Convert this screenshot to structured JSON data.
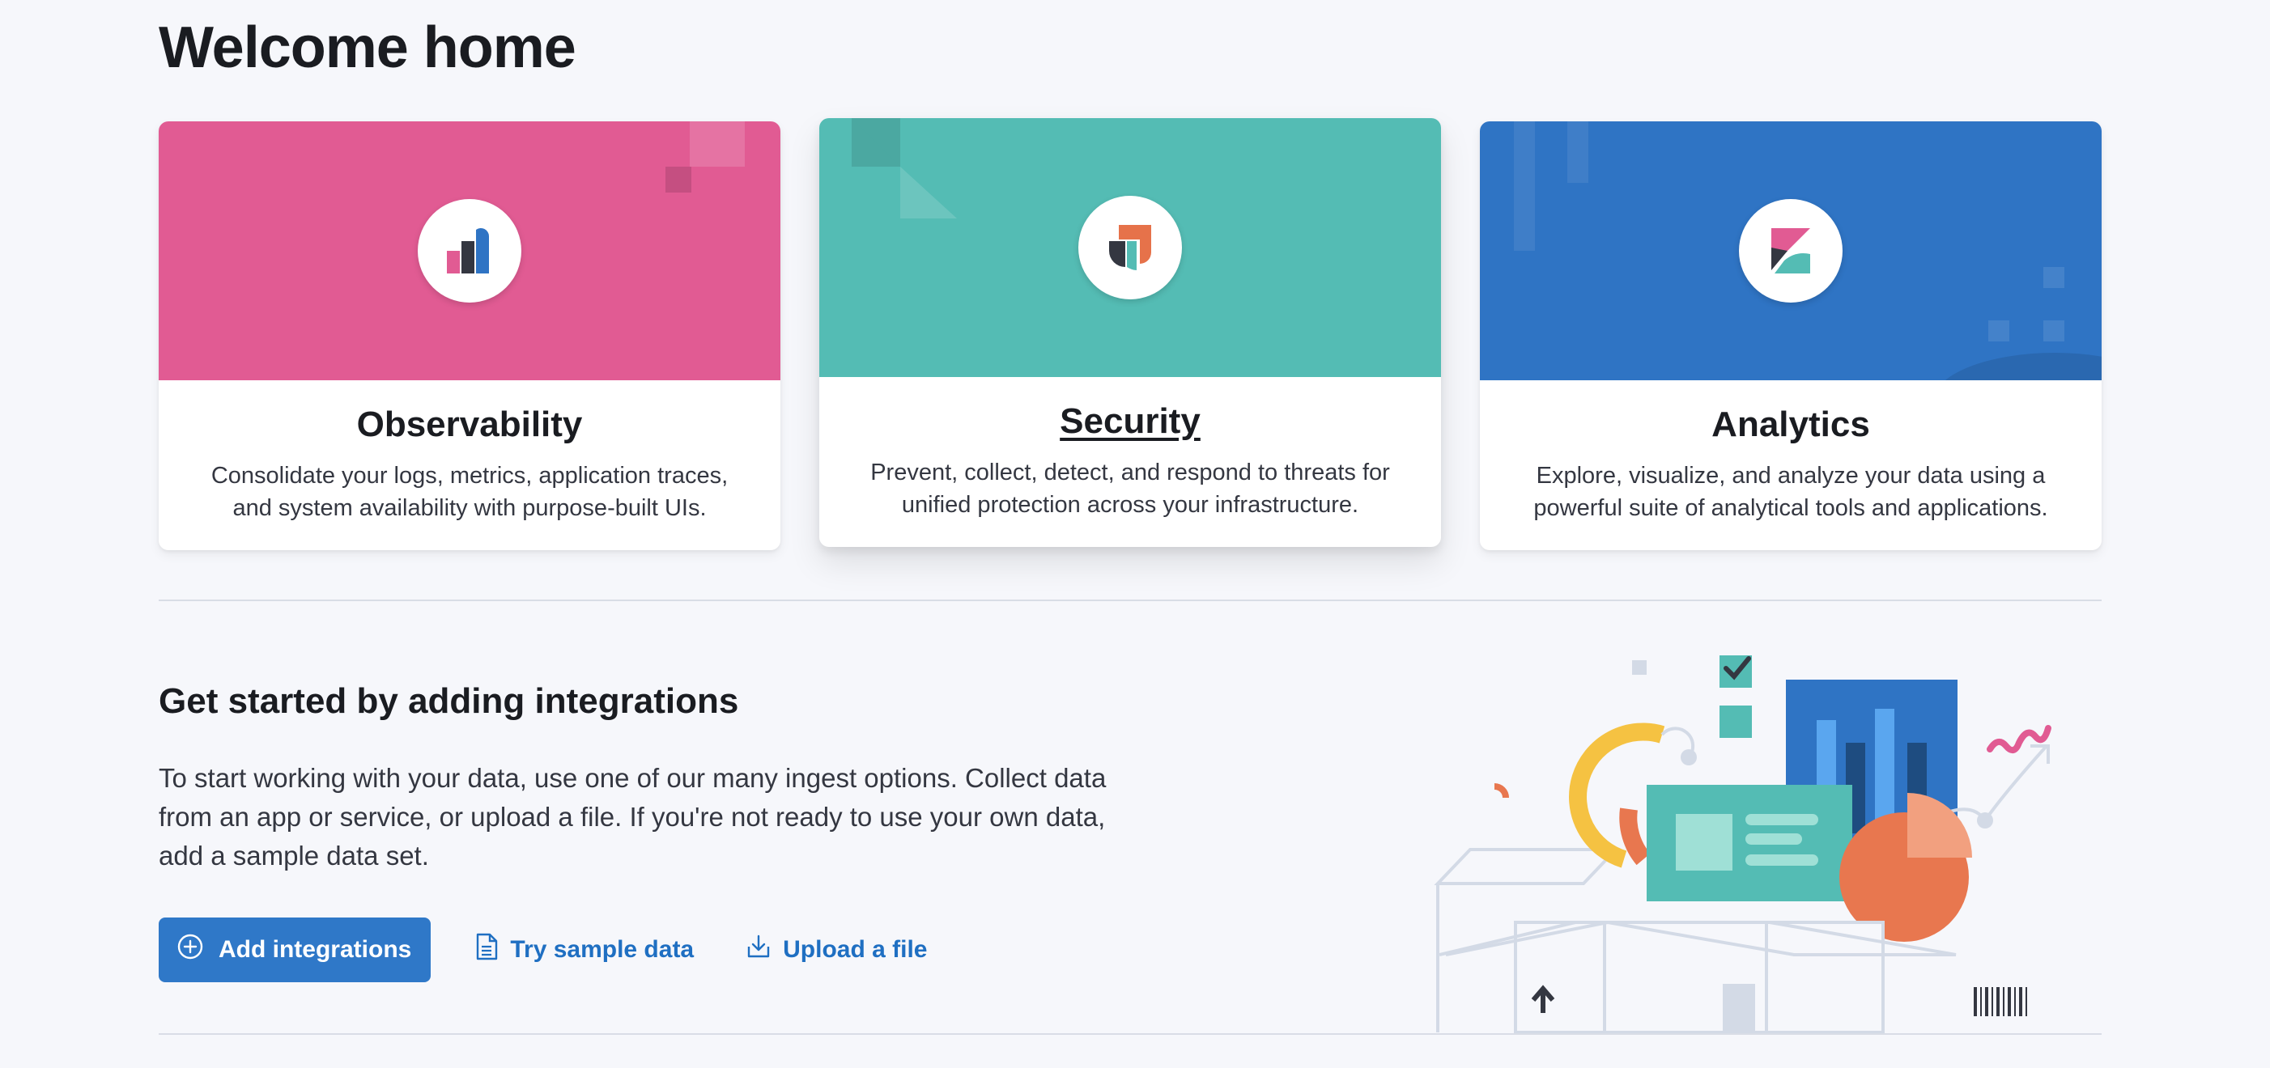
{
  "page": {
    "title": "Welcome home"
  },
  "solutions": [
    {
      "title": "Observability",
      "description_line1": "Consolidate your logs, metrics, application traces,",
      "description_line2": "and system availability with purpose-built UIs.",
      "color": "#e15b93",
      "icon": "observability-logo-icon"
    },
    {
      "title": "Security",
      "description_line1": "Prevent, collect, detect, and respond to threats for",
      "description_line2": "unified protection across your infrastructure.",
      "color": "#54bcb4",
      "icon": "security-logo-icon"
    },
    {
      "title": "Analytics",
      "description_line1": "Explore, visualize, and analyze your data using a",
      "description_line2": "powerful suite of analytical tools and applications.",
      "color": "#2f74c4",
      "icon": "kibana-logo-icon"
    }
  ],
  "integrations": {
    "title": "Get started by adding integrations",
    "description": "To start working with your data, use one of our many ingest options. Collect data from an app or service, or upload a file. If you're not ready to use your own data, add a sample data set.",
    "add_button": "Add integrations",
    "sample_link": "Try sample data",
    "upload_link": "Upload a file",
    "accent": "#2f78c8"
  }
}
